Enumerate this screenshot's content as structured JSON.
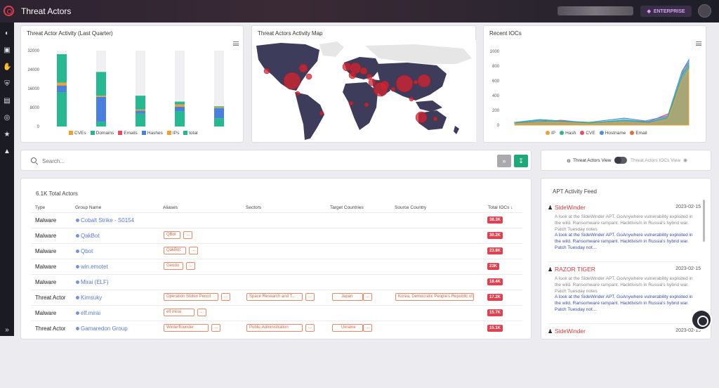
{
  "app": {
    "title": "Threat Actors",
    "enterprise_label": "ENTERPRISE"
  },
  "activity_chart": {
    "title": "Threat Actor Activity (Last Quarter)",
    "chart_data": {
      "type": "bar",
      "yticks": [
        "32000",
        "24000",
        "16000",
        "8000",
        "0"
      ],
      "ylim": [
        0,
        32000
      ],
      "series": [
        {
          "name": "CVEs",
          "color": "#f0a030"
        },
        {
          "name": "Domains",
          "color": "#26b890"
        },
        {
          "name": "Emails",
          "color": "#e84a5f"
        },
        {
          "name": "Hashes",
          "color": "#4a7fe0"
        },
        {
          "name": "IPs",
          "color": "#f0a030"
        },
        {
          "name": "total",
          "color": "#26b890"
        }
      ],
      "bars": [
        {
          "total": 30500,
          "domains": 14500,
          "ips": 1200,
          "hashes": 2800
        },
        {
          "total": 23000,
          "domains": 2000,
          "ips": 500,
          "hashes": 10500
        },
        {
          "total": 13000,
          "domains": 5500,
          "ips": 500,
          "hashes": 1200
        },
        {
          "total": 10500,
          "domains": 6500,
          "ips": 1000,
          "hashes": 1800
        },
        {
          "total": 8500,
          "domains": 3500,
          "ips": 400,
          "hashes": 4200
        }
      ]
    }
  },
  "map": {
    "title": "Threat Actors Activity Map"
  },
  "iocs_chart": {
    "title": "Recent IOCs",
    "chart_data": {
      "type": "area",
      "yticks": [
        "1000",
        "800",
        "600",
        "400",
        "200",
        "0"
      ],
      "ylim": [
        0,
        1000
      ],
      "series": [
        {
          "name": "IP",
          "color": "#f0a030"
        },
        {
          "name": "Hash",
          "color": "#26b890"
        },
        {
          "name": "CVE",
          "color": "#e84a5f"
        },
        {
          "name": "Hostname",
          "color": "#4a90e0"
        },
        {
          "name": "Email",
          "color": "#e86a3a"
        }
      ]
    }
  },
  "search": {
    "placeholder": "Search..."
  },
  "view_toggle": {
    "left": "Threat Actors View",
    "right": "Threat Actors IOCs View"
  },
  "table": {
    "total_label": "6.1K Total Actors",
    "headers": [
      "Type",
      "Group Name",
      "Aliases",
      "Sectors",
      "Target Countries",
      "Source Country",
      "Total IOCs"
    ],
    "rows": [
      {
        "type": "Malware",
        "group": "Cobalt Strike - S0154",
        "aliases": [],
        "sectors": [],
        "countries": [],
        "source": "",
        "iocs": "38.3K"
      },
      {
        "type": "Malware",
        "group": "QakBot",
        "aliases": [
          "QBot"
        ],
        "sectors": [],
        "countries": [],
        "source": "",
        "iocs": "30.2K"
      },
      {
        "type": "Malware",
        "group": "Qbot",
        "aliases": [
          "QakBot"
        ],
        "sectors": [],
        "countries": [],
        "source": "",
        "iocs": "23.8K"
      },
      {
        "type": "Malware",
        "group": "win.emotet",
        "aliases": [
          "Geodo"
        ],
        "sectors": [],
        "countries": [],
        "source": "",
        "iocs": "23K"
      },
      {
        "type": "Malware",
        "group": "Mirai (ELF)",
        "aliases": [],
        "sectors": [],
        "countries": [],
        "source": "",
        "iocs": "18.4K"
      },
      {
        "type": "Threat Actor",
        "group": "Kimsuky",
        "aliases": [
          "Operation Stolen Pencil"
        ],
        "sectors": [
          "Space Research and T..."
        ],
        "countries": [
          "Japan"
        ],
        "source": "Korea, Democratic People's Republic of...",
        "iocs": "17.2K"
      },
      {
        "type": "Malware",
        "group": "elf.mirai",
        "aliases": [
          "elf mirai"
        ],
        "sectors": [],
        "countries": [],
        "source": "",
        "iocs": "15.7K"
      },
      {
        "type": "Threat Actor",
        "group": "Gamaredon Group",
        "aliases": [
          "Winterflounder"
        ],
        "sectors": [
          "Public Administration"
        ],
        "countries": [
          "Ukraine"
        ],
        "source": "",
        "iocs": "15.1K"
      }
    ],
    "more_label": "..."
  },
  "feed": {
    "title": "APT Activity Feed",
    "items": [
      {
        "name": "SideWinder",
        "date": "2023-02-15",
        "text1": "A look at the SideWinder APT. GoAnywhere vulnerability exploited in the wild. Ransomware rampant. Hacktivism in Russia's hybrid war. Patch Tuesday notes",
        "text2": "A look at the SideWinder APT. GoAnywhere vulnerability exploited in the wild. Ransomware rampant. Hacktivism in Russia's hybrid war. Patch Tuesday not..."
      },
      {
        "name": "RAZOR TIGER",
        "date": "2023-02-15",
        "text1": "A look at the SideWinder APT. GoAnywhere vulnerability exploited in the wild. Ransomware rampant. Hacktivism in Russia's hybrid war. Patch Tuesday notes",
        "text2": "A look at the SideWinder APT. GoAnywhere vulnerability exploited in the wild. Ransomware rampant. Hacktivism in Russia's hybrid war. Patch Tuesday not..."
      },
      {
        "name": "SideWinder",
        "date": "2023-02-15",
        "text1": "",
        "text2": ""
      }
    ]
  }
}
